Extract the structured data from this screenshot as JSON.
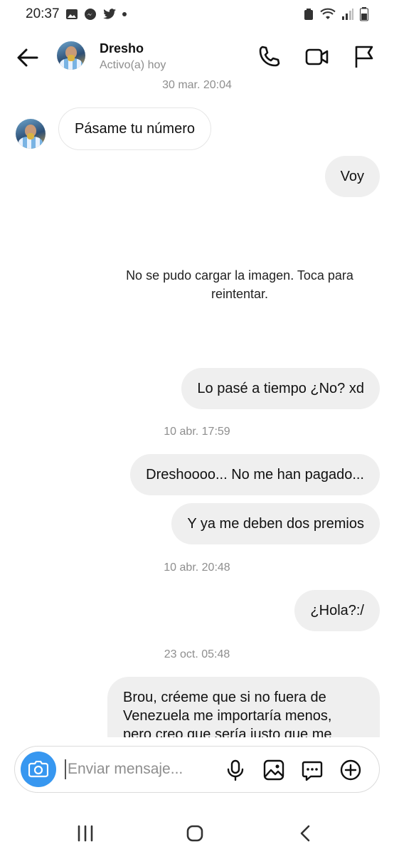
{
  "status_bar": {
    "time": "20:37"
  },
  "header": {
    "name": "Dresho",
    "status": "Activo(a) hoy"
  },
  "messages": {
    "ts1": "30 mar. 20:04",
    "m1": "Pásame tu número",
    "m2": "Voy",
    "image_error": "No se pudo cargar la imagen. Toca para reintentar.",
    "m3": "Lo pasé a tiempo ¿No? xd",
    "ts2": "10 abr. 17:59",
    "m4": "Dreshoooo... No me han pagado...",
    "m5": "Y ya me deben dos premios",
    "ts3": "10 abr. 20:48",
    "m6": "¿Hola?:/",
    "ts4": "23 oct. 05:48",
    "m7": "Brou, créeme que si no fuera de Venezuela me importaría menos, pero creo que sería justo que me"
  },
  "composer": {
    "placeholder": "Enviar mensaje..."
  },
  "colors": {
    "accent": "#3797f0",
    "outgoing_bubble": "#efefef",
    "muted_text": "#8e8e8e"
  }
}
